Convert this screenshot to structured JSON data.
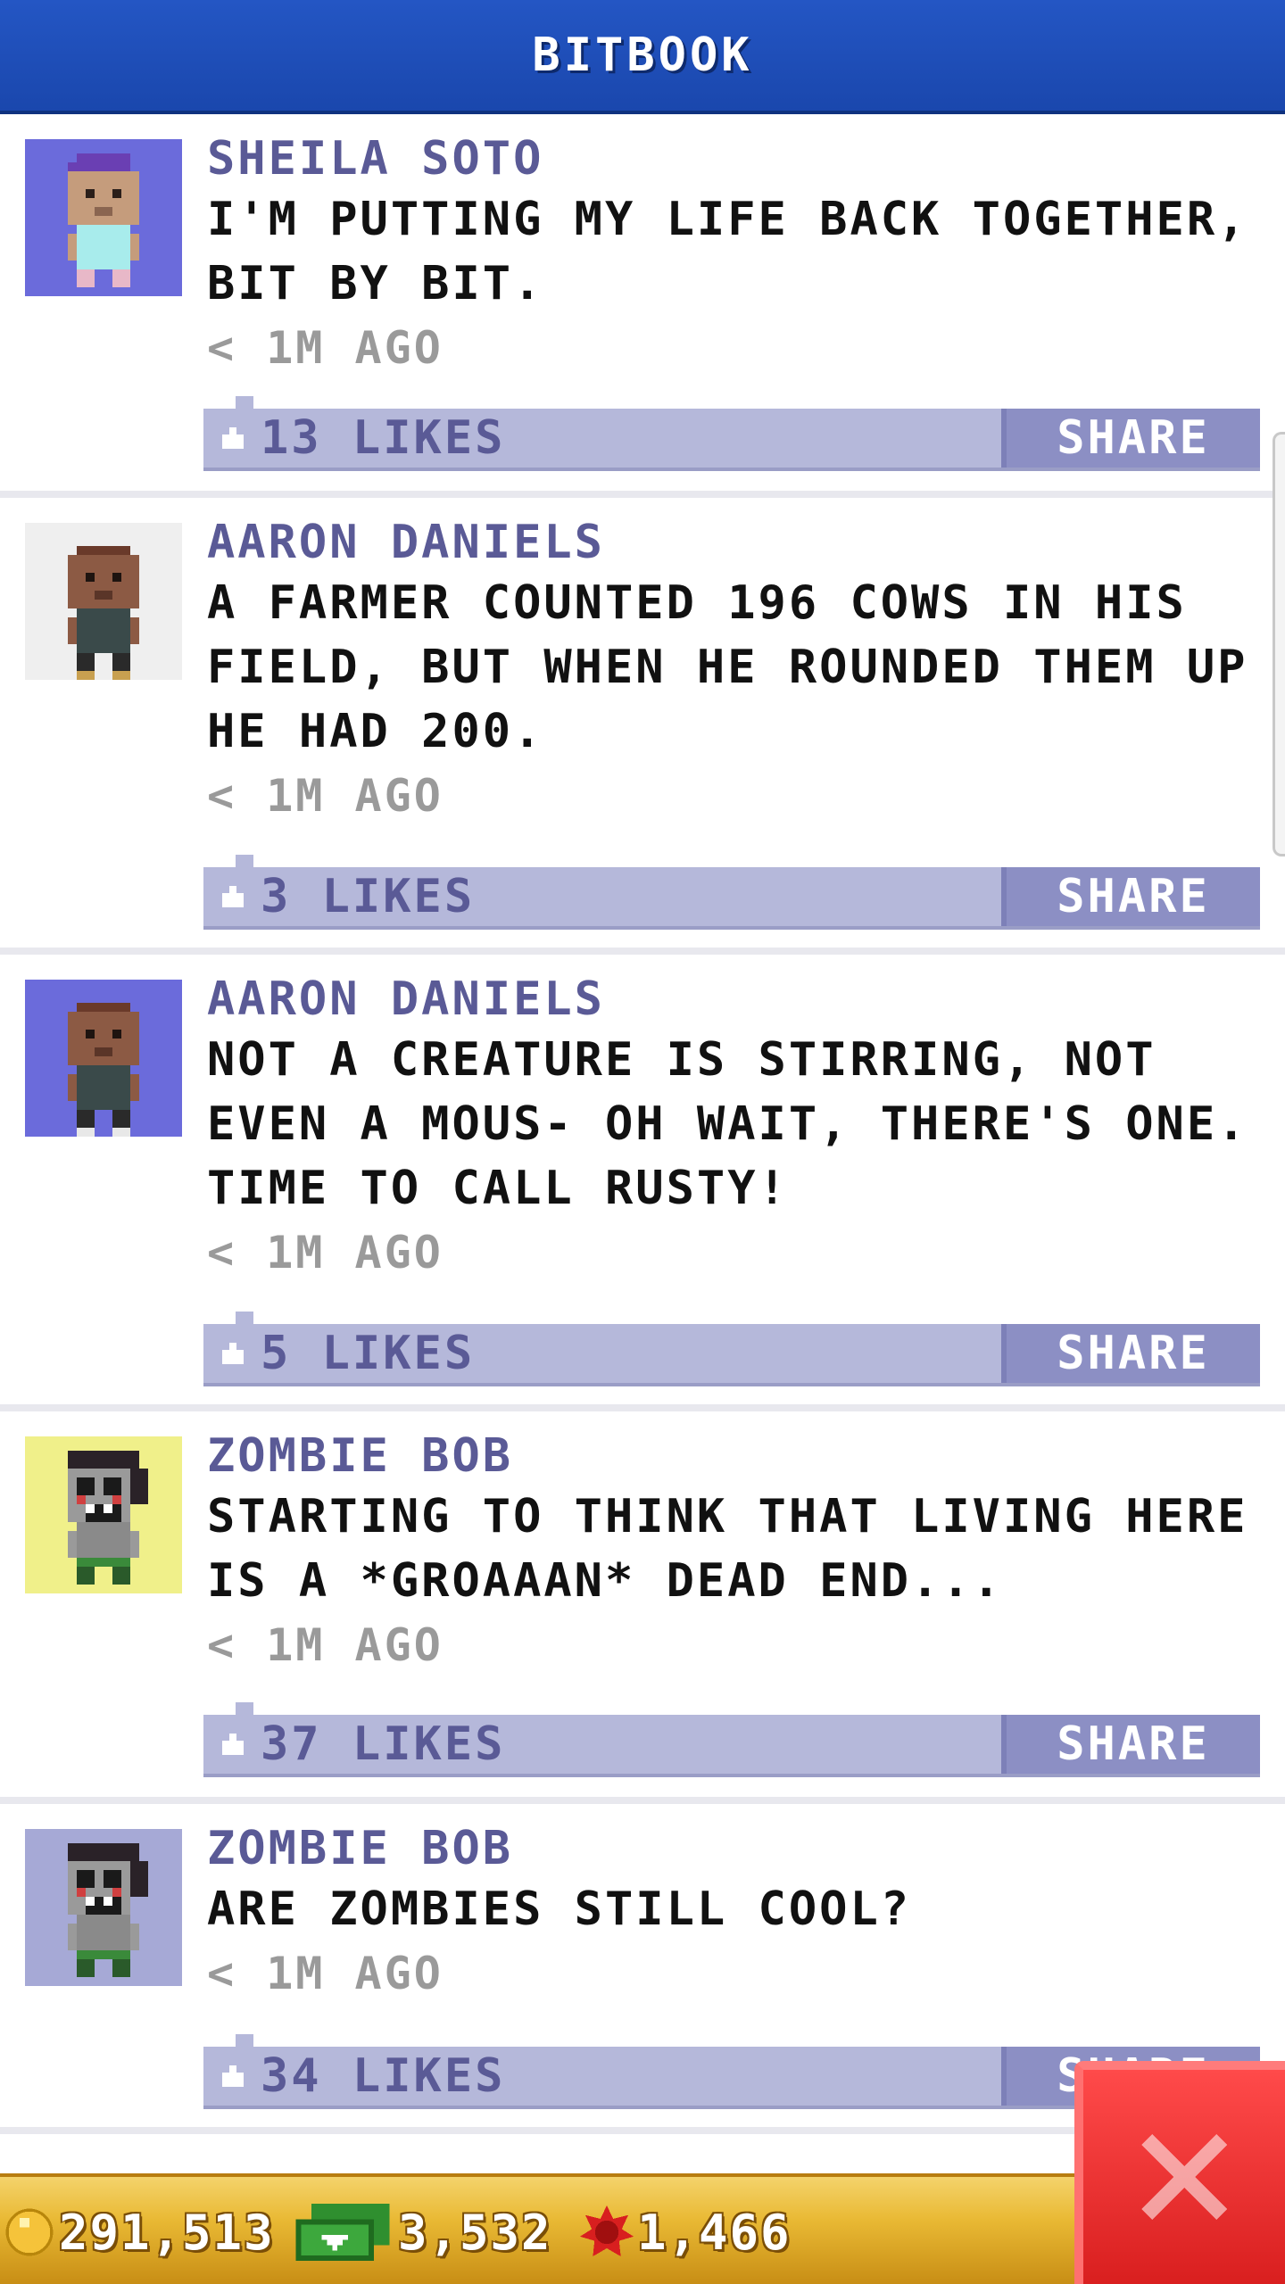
{
  "header": {
    "title": "BITBOOK"
  },
  "posts": [
    {
      "author": "SHEILA SOTO",
      "text": "I'M PUTTING MY LIFE BACK TOGETHER,\nBIT BY BIT.",
      "time": "< 1M AGO",
      "likes": "13 LIKES",
      "share": "SHARE",
      "avatar_bg": "#6b6bdb",
      "avatar": "sheila-soto-avatar"
    },
    {
      "author": "AARON DANIELS",
      "text": "A FARMER COUNTED 196 COWS IN HIS\nFIELD, BUT WHEN HE ROUNDED THEM UP\nHE HAD 200.",
      "time": "< 1M AGO",
      "likes": "3 LIKES",
      "share": "SHARE",
      "avatar_bg": "#efefef",
      "avatar": "aaron-daniels-avatar"
    },
    {
      "author": "AARON DANIELS",
      "text": "NOT A CREATURE IS STIRRING, NOT\nEVEN A MOUS- OH WAIT, THERE'S ONE.\nTIME TO CALL RUSTY!",
      "time": "< 1M AGO",
      "likes": "5 LIKES",
      "share": "SHARE",
      "avatar_bg": "#6b6bdb",
      "avatar": "aaron-daniels-avatar"
    },
    {
      "author": "ZOMBIE BOB",
      "text": "STARTING TO THINK THAT LIVING HERE\nIS A *GROAAAN* DEAD END...",
      "time": "< 1M AGO",
      "likes": "37 LIKES",
      "share": "SHARE",
      "avatar_bg": "#f0f08a",
      "avatar": "zombie-bob-avatar"
    },
    {
      "author": "ZOMBIE BOB",
      "text": "ARE ZOMBIES STILL COOL?",
      "time": "< 1M AGO",
      "likes": "34 LIKES",
      "share": "SHARE",
      "avatar_bg": "#a6a9d6",
      "avatar": "zombie-bob-avatar"
    }
  ],
  "currency": {
    "coins": "291,513",
    "bux": "3,532",
    "gems": "1,466"
  },
  "colors": {
    "header": "#1a47ad",
    "likes_bar": "#b5b8da",
    "share_button": "#8c8fc4",
    "author_text": "#5a5a96",
    "bottom_bar": "#e9b934",
    "close_button": "#e02a2a"
  }
}
